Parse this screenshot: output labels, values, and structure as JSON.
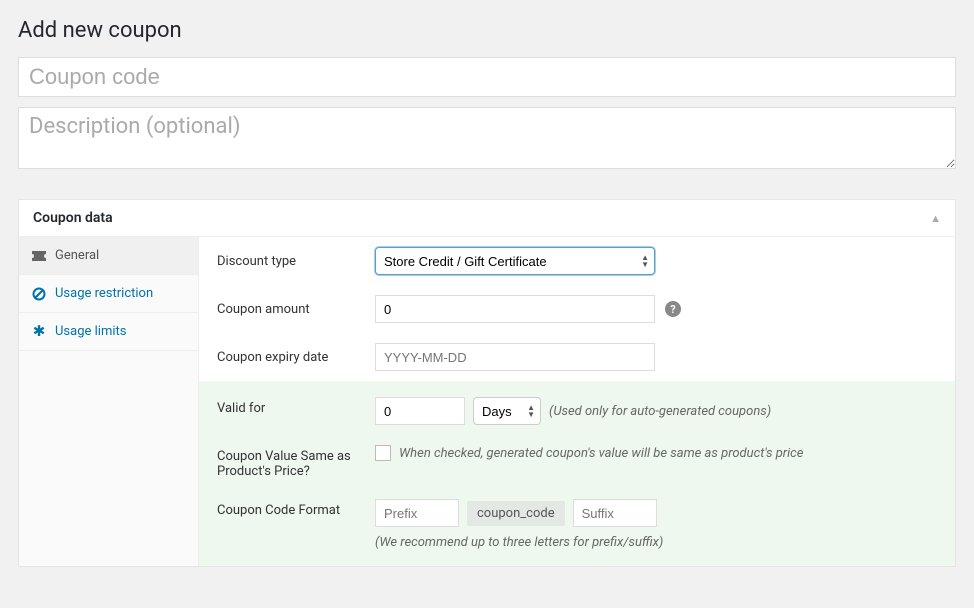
{
  "page_title": "Add new coupon",
  "title_placeholder": "Coupon code",
  "description_placeholder": "Description (optional)",
  "panel_title": "Coupon data",
  "tabs": {
    "general": "General",
    "usage_restriction": "Usage restriction",
    "usage_limits": "Usage limits"
  },
  "fields": {
    "discount_type": {
      "label": "Discount type",
      "value": "Store Credit / Gift Certificate"
    },
    "coupon_amount": {
      "label": "Coupon amount",
      "value": "0"
    },
    "expiry": {
      "label": "Coupon expiry date",
      "placeholder": "YYYY-MM-DD"
    },
    "valid_for": {
      "label": "Valid for",
      "value": "0",
      "unit": "Days",
      "hint": "(Used only for auto-generated coupons)"
    },
    "same_as_price": {
      "label": "Coupon Value Same as Product's Price?",
      "hint": "When checked, generated coupon's value will be same as product's price"
    },
    "code_format": {
      "label": "Coupon Code Format",
      "prefix_placeholder": "Prefix",
      "code_label": "coupon_code",
      "suffix_placeholder": "Suffix",
      "hint": "(We recommend up to three letters for prefix/suffix)"
    }
  }
}
